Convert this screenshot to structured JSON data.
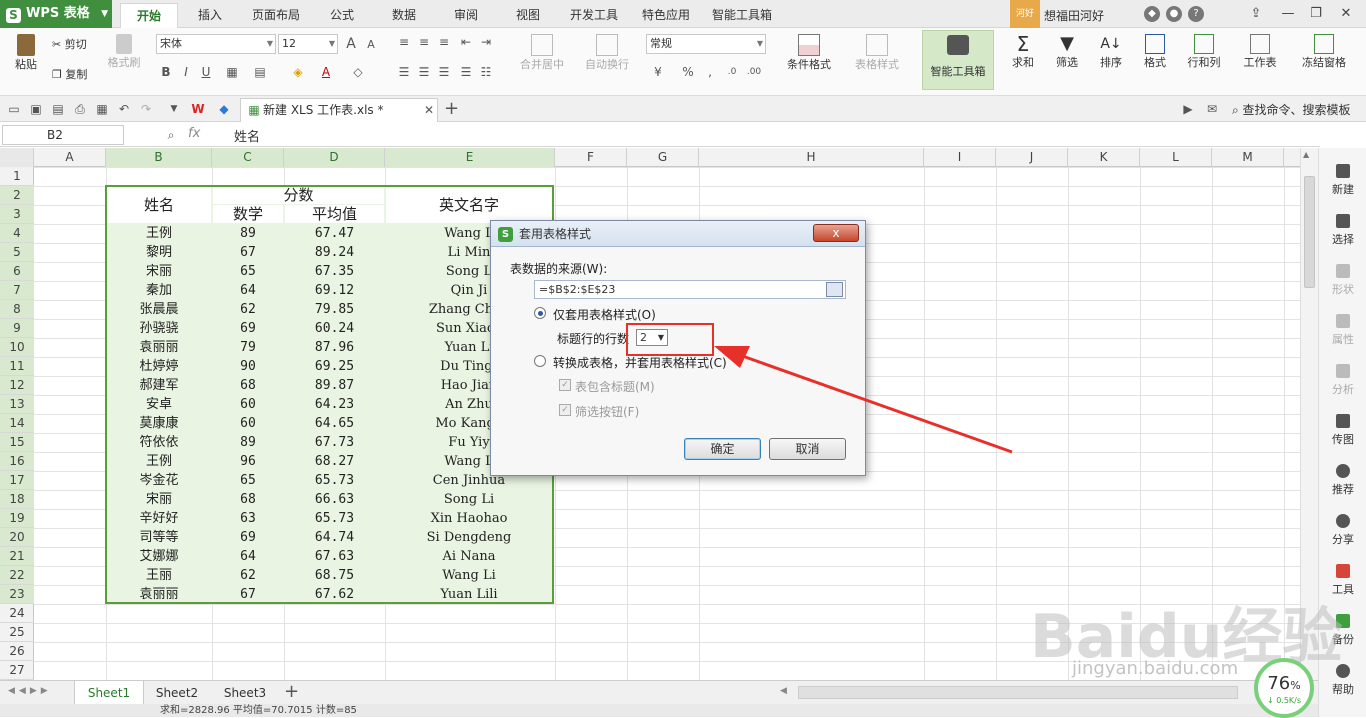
{
  "app": {
    "logo": "WPS 表格",
    "logo_mark": "S"
  },
  "menu_tabs": [
    "开始",
    "插入",
    "页面布局",
    "公式",
    "数据",
    "审阅",
    "视图",
    "开发工具",
    "特色应用",
    "智能工具箱"
  ],
  "user": {
    "badge": "河好",
    "name": "想福田河好"
  },
  "ribbon": {
    "paste": "粘贴",
    "cut": "剪切",
    "copy": "复制",
    "format_painter": "格式刷",
    "font": "宋体",
    "size": "12",
    "bold": "B",
    "italic": "I",
    "underline": "U",
    "merge": "合并居中",
    "wrap": "自动换行",
    "number_format": "常规",
    "percent": "%",
    "cond_format": "条件格式",
    "table_style": "表格样式",
    "smart_toolbox": "智能工具箱",
    "sum": "求和",
    "filter": "筛选",
    "sort": "排序",
    "format": "格式",
    "row_col": "行和列",
    "worksheet": "工作表",
    "freeze": "冻结窗格"
  },
  "quickbar": {
    "file_tab": "新建 XLS 工作表.xls *",
    "new_tab": "+",
    "search": "查找命令、搜索模板"
  },
  "formula": {
    "cell_ref": "B2",
    "fx": "fx",
    "content": "姓名"
  },
  "columns": [
    "A",
    "B",
    "C",
    "D",
    "E",
    "F",
    "G",
    "H",
    "I",
    "J",
    "K",
    "L",
    "M"
  ],
  "rows": [
    "1",
    "2",
    "3",
    "4",
    "5",
    "6",
    "7",
    "8",
    "9",
    "10",
    "11",
    "12",
    "13",
    "14",
    "15",
    "16",
    "17",
    "18",
    "19",
    "20",
    "21",
    "22",
    "23",
    "24",
    "25",
    "26",
    "27"
  ],
  "table": {
    "h_name": "姓名",
    "h_score": "分数",
    "h_math": "数学",
    "h_avg": "平均值",
    "h_en": "英文名字",
    "data": [
      [
        "王例",
        "89",
        "67.47",
        "Wang L"
      ],
      [
        "黎明",
        "67",
        "89.24",
        "Li Min"
      ],
      [
        "宋丽",
        "65",
        "67.35",
        "Song L"
      ],
      [
        "秦加",
        "64",
        "69.12",
        "Qin Ji"
      ],
      [
        "张晨晨",
        "62",
        "79.85",
        "Zhang Chen"
      ],
      [
        "孙骁骁",
        "69",
        "60.24",
        "Sun Xiaox"
      ],
      [
        "袁丽丽",
        "79",
        "87.96",
        "Yuan Li"
      ],
      [
        "杜婷婷",
        "90",
        "69.25",
        "Du Tingt"
      ],
      [
        "郝建军",
        "68",
        "89.87",
        "Hao Jian"
      ],
      [
        "安卓",
        "60",
        "64.23",
        "An Zhu"
      ],
      [
        "莫康康",
        "60",
        "64.65",
        "Mo Kangk"
      ],
      [
        "符依依",
        "89",
        "67.73",
        "Fu Yiy"
      ],
      [
        "王例",
        "96",
        "68.27",
        "Wang L"
      ],
      [
        "岑金花",
        "65",
        "65.73",
        "Cen Jinhua"
      ],
      [
        "宋丽",
        "68",
        "66.63",
        "Song Li"
      ],
      [
        "辛好好",
        "63",
        "65.73",
        "Xin Haohao"
      ],
      [
        "司等等",
        "69",
        "64.74",
        "Si Dengdeng"
      ],
      [
        "艾娜娜",
        "64",
        "67.63",
        "Ai Nana"
      ],
      [
        "王丽",
        "62",
        "68.75",
        "Wang Li"
      ],
      [
        "袁丽丽",
        "67",
        "67.62",
        "Yuan Lili"
      ]
    ]
  },
  "dialog": {
    "title": "套用表格样式",
    "close": "x",
    "source_label": "表数据的来源(W):",
    "source_value": "=$B$2:$E$23",
    "opt1": "仅套用表格样式(O)",
    "header_rows_label": "标题行的行数",
    "header_rows": "2",
    "opt2": "转换成表格，并套用表格样式(C)",
    "chk1": "表包含标题(M)",
    "chk2": "筛选按钮(F)",
    "ok": "确定",
    "cancel": "取消"
  },
  "right_panel": [
    "新建",
    "选择",
    "形状",
    "属性",
    "分析",
    "传图",
    "推荐",
    "分享",
    "工具",
    "备份",
    "帮助"
  ],
  "sheets": [
    "Sheet1",
    "Sheet2",
    "Sheet3"
  ],
  "status": {
    "text": "求和=2828.96   平均值=70.7015   计数=85"
  },
  "speed": {
    "value": "76",
    "unit": "%",
    "rate": "↓ 0.5K/s"
  },
  "watermark": {
    "main": "Baidu经验",
    "sub": "jingyan.baidu.com"
  },
  "colors": {
    "accent": "#3f8f3f",
    "selection": "#5a9e3a",
    "highlight": "#e8302a"
  }
}
